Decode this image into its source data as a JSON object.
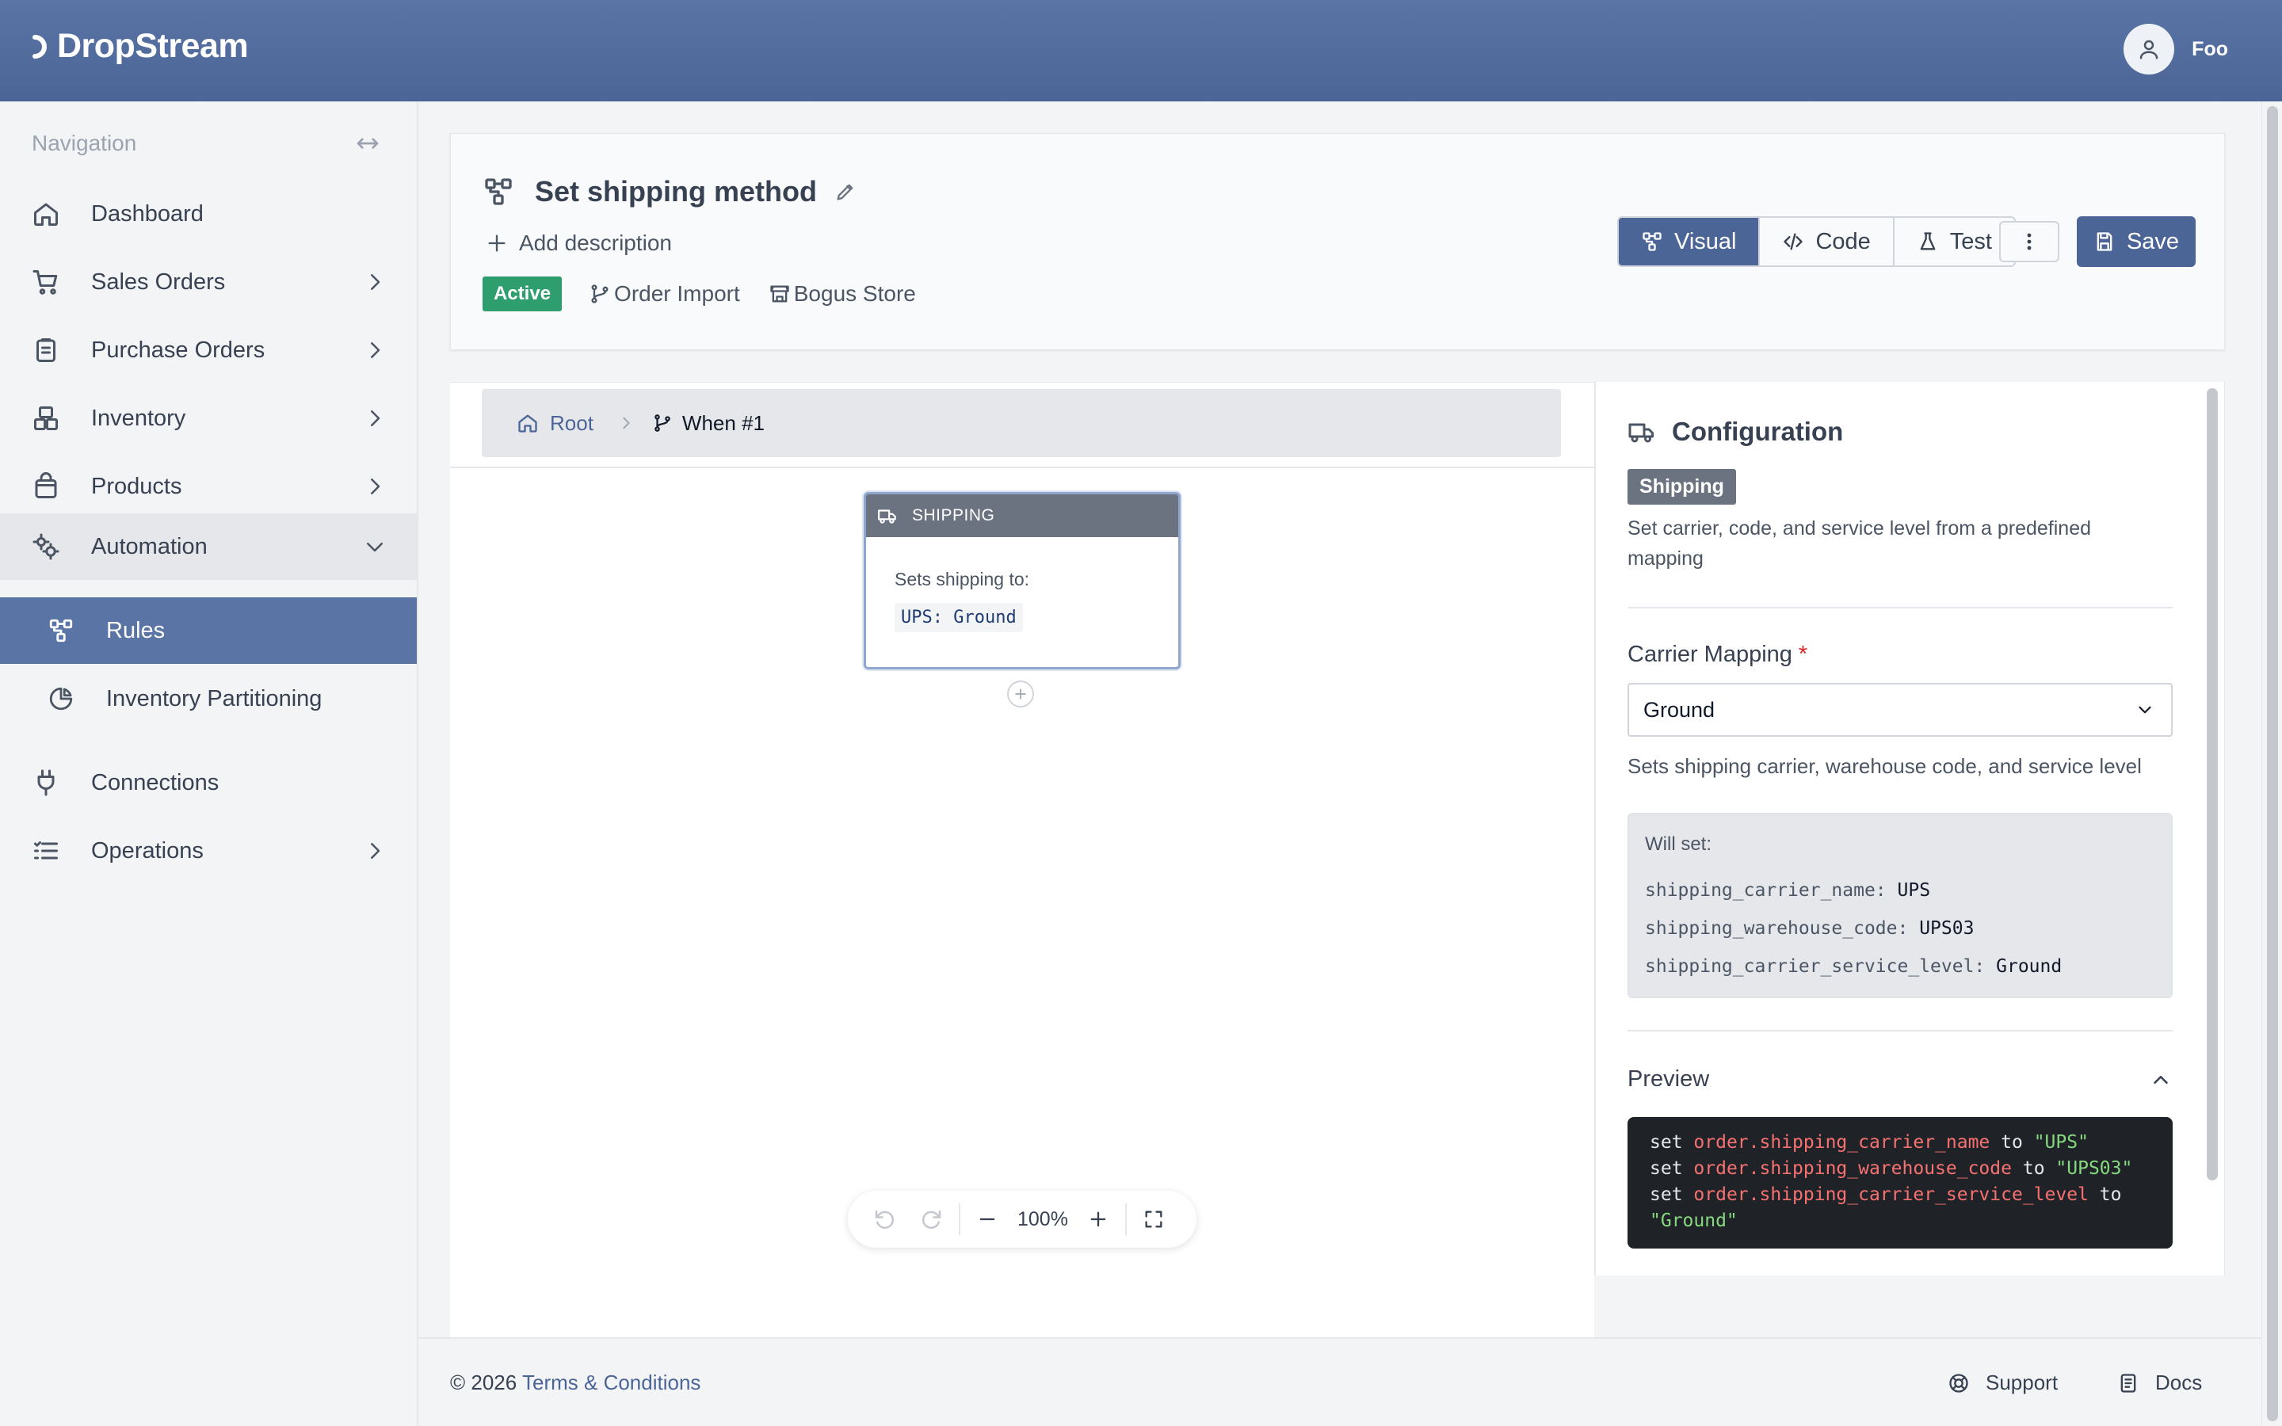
{
  "app": {
    "brand": "DropStream",
    "user_name": "Foo"
  },
  "sidebar": {
    "heading": "Navigation",
    "items": [
      {
        "label": "Dashboard",
        "icon": "home-icon"
      },
      {
        "label": "Sales Orders",
        "icon": "cart-icon"
      },
      {
        "label": "Purchase Orders",
        "icon": "clipboard-icon"
      },
      {
        "label": "Inventory",
        "icon": "boxes-icon"
      },
      {
        "label": "Products",
        "icon": "bag-icon"
      },
      {
        "label": "Automation",
        "icon": "gears-icon",
        "expanded": true
      },
      {
        "label": "Connections",
        "icon": "plug-icon"
      },
      {
        "label": "Operations",
        "icon": "list-icon"
      }
    ],
    "sub_items": [
      {
        "label": "Rules",
        "active": true
      },
      {
        "label": "Inventory Partitioning",
        "active": false
      }
    ]
  },
  "header": {
    "title": "Set shipping method",
    "add_description": "Add description",
    "status": "Active",
    "trigger": "Order Import",
    "store": "Bogus Store",
    "tabs": {
      "visual": "Visual",
      "code": "Code",
      "test": "Test"
    },
    "save_label": "Save"
  },
  "canvas": {
    "breadcrumb": {
      "root": "Root",
      "current": "When #1"
    },
    "node": {
      "header": "SHIPPING",
      "subtitle": "Sets shipping to:",
      "value": "UPS: Ground"
    },
    "zoom": "100%"
  },
  "config": {
    "title": "Configuration",
    "tag": "Shipping",
    "description": "Set carrier, code, and service level from a predefined mapping",
    "field_label": "Carrier Mapping",
    "required_mark": "*",
    "select_value": "Ground",
    "help": "Sets shipping carrier, warehouse code, and service level",
    "will_set": {
      "title": "Will set:",
      "rows": [
        {
          "key": "shipping_carrier_name:",
          "value": "UPS"
        },
        {
          "key": "shipping_warehouse_code:",
          "value": "UPS03"
        },
        {
          "key": "shipping_carrier_service_level:",
          "value": "Ground"
        }
      ]
    },
    "preview_label": "Preview",
    "preview_code": [
      {
        "kw": "set",
        "path": "order.shipping_carrier_name",
        "to": "to",
        "val": "\"UPS\""
      },
      {
        "kw": "set",
        "path": "order.shipping_warehouse_code",
        "to": "to",
        "val": "\"UPS03\""
      },
      {
        "kw": "set",
        "path": "order.shipping_carrier_service_level",
        "to": "to",
        "val": "\"Ground\""
      }
    ]
  },
  "footer": {
    "copyright": "© 2026",
    "terms": "Terms & Conditions",
    "support": "Support",
    "docs": "Docs"
  },
  "colors": {
    "brand": "#4c6597",
    "active_badge": "#2f9e6f",
    "code_bg": "#1f2328"
  }
}
